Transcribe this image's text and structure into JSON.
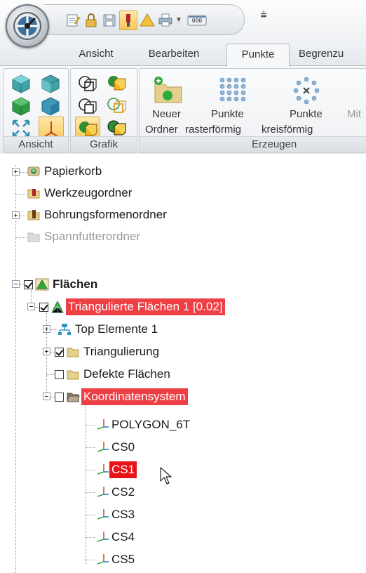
{
  "quick_access": {
    "items": [
      "notes-icon",
      "lock-icon",
      "save-icon",
      "tool-holder-icon",
      "warning-icon",
      "print-icon",
      "counter-icon"
    ],
    "more_label": "⩧"
  },
  "tabs": [
    {
      "label": "Ansicht",
      "active": false
    },
    {
      "label": "Bearbeiten",
      "active": false
    },
    {
      "label": "Punkte",
      "active": true
    },
    {
      "label": "Begrenzu",
      "active": false
    }
  ],
  "ribbon": {
    "groups": [
      {
        "label": "Ansicht"
      },
      {
        "label": "Grafik"
      },
      {
        "label": "Erzeugen"
      }
    ],
    "erzeugen": {
      "neuer_top": "Neuer",
      "neuer_bottom": "Ordner",
      "raster_top": "Punkte",
      "raster_bottom": "rasterförmig",
      "kreis_top": "Punkte",
      "kreis_bottom": "kreisförmig",
      "cut_label": "Mit"
    }
  },
  "tree": {
    "nodes": [
      {
        "label": "Papierkorb",
        "icon": "recycle-bin-icon"
      },
      {
        "label": "Werkzeugordner",
        "icon": "tool-folder-icon"
      },
      {
        "label": "Bohrungsformenordner",
        "icon": "hole-shape-folder-icon"
      },
      {
        "label": "Spannfutterordner",
        "icon": "chuck-folder-icon"
      },
      {
        "label": "Flächen",
        "icon": "surfaces-icon",
        "checked": true
      },
      {
        "label": "Triangulierte Flächen 1 [0.02]",
        "icon": "triangulated-surface-icon",
        "checked": true
      },
      {
        "label": "Top Elemente 1",
        "icon": "top-elements-icon"
      },
      {
        "label": "Triangulierung",
        "icon": "folder-icon",
        "checked": true
      },
      {
        "label": "Defekte Flächen",
        "icon": "folder-icon",
        "checked": false
      },
      {
        "label": "Koordinatensystem",
        "icon": "open-folder-icon",
        "checked": false
      },
      {
        "label": "POLYGON_6T",
        "icon": "coordinate-axes-icon"
      },
      {
        "label": "CS0",
        "icon": "coordinate-axes-icon"
      },
      {
        "label": "CS1",
        "icon": "coordinate-axes-icon"
      },
      {
        "label": "CS2",
        "icon": "coordinate-axes-icon"
      },
      {
        "label": "CS3",
        "icon": "coordinate-axes-icon"
      },
      {
        "label": "CS4",
        "icon": "coordinate-axes-icon"
      },
      {
        "label": "CS5",
        "icon": "coordinate-axes-icon"
      }
    ]
  },
  "colors": {
    "highlight": "#ee3f45",
    "selection": "#e81218",
    "accent_green": "#2eaa3c",
    "folder": "#e5cf8c"
  }
}
